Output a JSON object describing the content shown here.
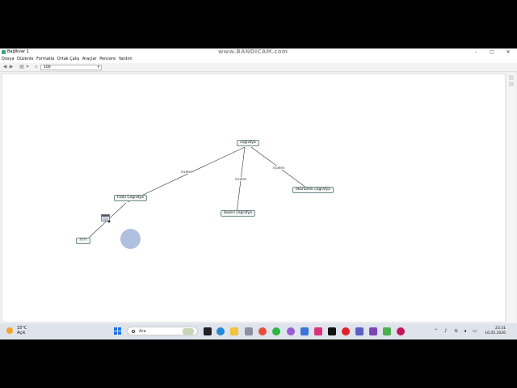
{
  "window": {
    "title": "Bağlkvar 1",
    "watermark": "www.BANDICAM.com",
    "minimize": "–",
    "maximize": "▢",
    "close": "✕"
  },
  "menu": [
    "Dosya",
    "Düzenle",
    "Formatla",
    "Ortak Çalış",
    "Araçlar",
    "Pencere",
    "Yardım"
  ],
  "toolbar": {
    "zoom_value": "100"
  },
  "map": {
    "nodes": {
      "root": "coğrafya",
      "physical": "Fiziki Coğrafya",
      "human": "beşeri coğrafya",
      "economic": "ekonomik coğrafya",
      "unknown": "????"
    },
    "links": {
      "left": "incelen",
      "middle": "incelen",
      "right": "incelen"
    }
  },
  "taskbar": {
    "weather_temp": "15°C",
    "weather_desc": "Açık",
    "search_placeholder": "Ara",
    "time": "23:31",
    "date": "16.05.2026"
  }
}
